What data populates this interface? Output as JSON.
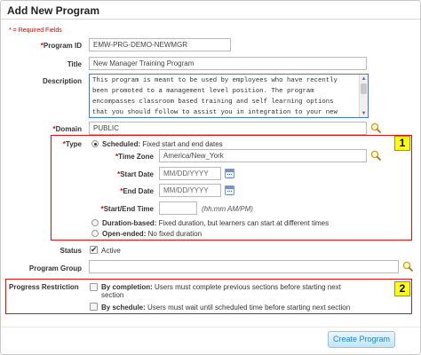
{
  "form": {
    "title": "Add New Program",
    "required_note": "* = Required Fields",
    "fields": {
      "program_id": {
        "label": "Program ID",
        "value": "EMW-PRG-DEMO-NEWMGR",
        "required": true
      },
      "title": {
        "label": "Title",
        "value": "New Manager Training Program"
      },
      "description": {
        "label": "Description",
        "lines": [
          "This program is meant to be used by employees who have recently",
          "been promoted to a management level position.  The program",
          "encompasses classroom based training and self learning options",
          "that you should follow to assist you in integration to your new"
        ]
      },
      "domain": {
        "label": "Domain",
        "value": "PUBLIC",
        "required": true
      }
    },
    "type": {
      "label": "Type",
      "badge": "1",
      "scheduled": {
        "name": "Scheduled:",
        "desc": "Fixed start and end dates",
        "selected": true
      },
      "time_zone": {
        "label": "Time Zone",
        "value": "America/New_York"
      },
      "start_date": {
        "label": "Start Date",
        "placeholder": "MM/DD/YYYY"
      },
      "end_date": {
        "label": "End Date",
        "placeholder": "MM/DD/YYYY"
      },
      "start_end_time": {
        "label": "Start/End Time",
        "hint": "(hh:mm AM/PM)"
      },
      "duration_based": {
        "name": "Duration-based:",
        "desc": "Fixed duration, but learners can start at different times"
      },
      "open_ended": {
        "name": "Open-ended:",
        "desc": "No fixed duration"
      }
    },
    "status": {
      "label": "Status",
      "option": "Active",
      "checked": true
    },
    "program_group": {
      "label": "Program Group",
      "value": ""
    },
    "progress_restriction": {
      "label": "Progress Restriction",
      "badge": "2",
      "by_completion": {
        "name": "By completion:",
        "desc_line1": "Users must complete previous sections before starting next",
        "desc_line2": "section"
      },
      "by_schedule": {
        "name": "By schedule:",
        "desc": "Users must wait until scheduled time before starting next section"
      }
    },
    "create_button": "Create Program"
  },
  "colors": {
    "required_star": "#dd0000",
    "highlight_box": "#dd1111",
    "badge": "#ffff00",
    "button_text": "#1a86c8"
  }
}
